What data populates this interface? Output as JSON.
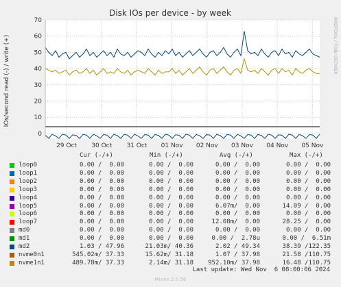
{
  "title": "Disk IOs per device - by week",
  "side_label": "RRDTOOL / TOBI OETIKER",
  "ylabel": "IOs/second read (-) / write (+)",
  "footer": "Munin 2.0.56",
  "last_update": "Last update: Wed Nov  6 08:00:06 2024",
  "legend_headers": {
    "cur": "Cur (-/+)",
    "min": "Min (-/+)",
    "avg": "Avg (-/+)",
    "max": "Max (-/+)"
  },
  "legend": [
    {
      "name": "loop0",
      "color": "#00cc00",
      "cur": "0.00 /  0.00",
      "min": "0.00 /  0.00",
      "avg": "0.00 /  0.00",
      "max": "0.00 /  0.00"
    },
    {
      "name": "loop1",
      "color": "#0066b3",
      "cur": "0.00 /  0.00",
      "min": "0.00 /  0.00",
      "avg": "0.00 /  0.00",
      "max": "0.00 /  0.00"
    },
    {
      "name": "loop2",
      "color": "#ff8000",
      "cur": "0.00 /  0.00",
      "min": "0.00 /  0.00",
      "avg": "0.00 /  0.00",
      "max": "0.00 /  0.00"
    },
    {
      "name": "loop3",
      "color": "#ffcc00",
      "cur": "0.00 /  0.00",
      "min": "0.00 /  0.00",
      "avg": "0.00 /  0.00",
      "max": "0.00 /  0.00"
    },
    {
      "name": "loop4",
      "color": "#330099",
      "cur": "0.00 /  0.00",
      "min": "0.00 /  0.00",
      "avg": "0.00 /  0.00",
      "max": "0.00 /  0.00"
    },
    {
      "name": "loop5",
      "color": "#990099",
      "cur": "0.00 /  0.00",
      "min": "0.00 /  0.00",
      "avg": "6.07m/  0.00",
      "max": "14.09 /  0.00"
    },
    {
      "name": "loop6",
      "color": "#ccff00",
      "cur": "0.00 /  0.00",
      "min": "0.00 /  0.00",
      "avg": "0.00 /  0.00",
      "max": "0.00 /  0.00"
    },
    {
      "name": "loop7",
      "color": "#ff0000",
      "cur": "0.00 /  0.00",
      "min": "0.00 /  0.00",
      "avg": "12.08m/  0.00",
      "max": "28.25 /  0.00"
    },
    {
      "name": "md0",
      "color": "#808080",
      "cur": "0.00 /  0.00",
      "min": "0.00 /  0.00",
      "avg": "0.00 /  0.00",
      "max": "0.00 /  0.00"
    },
    {
      "name": "md1",
      "color": "#008f00",
      "cur": "0.00 /  0.00",
      "min": "0.00 /  0.00",
      "avg": "0.00 /  2.78u",
      "max": "0.00 /  6.51m"
    },
    {
      "name": "md2",
      "color": "#00487d",
      "cur": "1.03 / 47.96",
      "min": "21.03m/ 40.36",
      "avg": "2.02 / 49.34",
      "max": "38.39 /122.35"
    },
    {
      "name": "nvme0n1",
      "color": "#b35a00",
      "cur": "545.02m/ 37.33",
      "min": "15.62m/ 31.18",
      "avg": "1.07 / 37.98",
      "max": "21.58 /110.75"
    },
    {
      "name": "nvme1n1",
      "color": "#b38f00",
      "cur": "489.78m/ 37.33",
      "min": "2.14m/ 31.18",
      "avg": "952.10m/ 37.98",
      "max": "16.48 /110.75"
    }
  ],
  "chart_data": {
    "type": "line",
    "title": "Disk IOs per device - by week",
    "ylabel": "IOs/second read (-) / write (+)",
    "ylim": [
      -3,
      70
    ],
    "yticks": [
      "0",
      "10",
      "20",
      "30",
      "40",
      "50",
      "60",
      "70"
    ],
    "x_categories": [
      "29 Oct",
      "30 Oct",
      "31 Oct",
      "01 Nov",
      "02 Nov",
      "03 Nov",
      "04 Nov",
      "05 Nov"
    ],
    "grid": true,
    "series": [
      {
        "name": "md2",
        "color": "#00487d",
        "x": [
          0,
          1,
          2,
          3,
          4,
          5,
          6,
          7,
          8,
          9,
          10,
          11,
          12,
          13,
          14,
          15,
          16,
          17,
          18,
          19,
          20,
          21,
          22,
          23,
          24,
          25,
          26,
          27,
          28,
          29,
          30,
          31,
          32,
          33,
          34,
          35,
          36,
          37,
          38,
          39,
          40,
          41,
          42,
          43,
          44,
          45,
          46,
          47,
          48,
          49,
          50,
          51,
          52,
          53,
          54,
          55,
          56,
          57,
          58,
          59,
          60,
          61,
          62,
          63,
          64,
          65,
          66,
          67,
          68,
          69,
          70,
          71,
          72,
          73,
          74,
          75,
          76,
          77,
          78,
          79,
          80
        ],
        "values": [
          53,
          50,
          48,
          51,
          47,
          49,
          50,
          46,
          48,
          50,
          47,
          49,
          52,
          48,
          50,
          47,
          49,
          51,
          48,
          50,
          47,
          52,
          49,
          48,
          50,
          47,
          49,
          51,
          50,
          48,
          52,
          49,
          47,
          50,
          48,
          51,
          49,
          52,
          48,
          50,
          47,
          49,
          51,
          48,
          50,
          52,
          49,
          47,
          50,
          51,
          48,
          50,
          53,
          49,
          47,
          50,
          52,
          48,
          63,
          51,
          49,
          50,
          48,
          52,
          49,
          47,
          50,
          51,
          48,
          52,
          49,
          50,
          47,
          51,
          49,
          48,
          50,
          52,
          49,
          48,
          47
        ]
      },
      {
        "name": "nvme1n1",
        "color": "#b38f00",
        "x": [
          0,
          1,
          2,
          3,
          4,
          5,
          6,
          7,
          8,
          9,
          10,
          11,
          12,
          13,
          14,
          15,
          16,
          17,
          18,
          19,
          20,
          21,
          22,
          23,
          24,
          25,
          26,
          27,
          28,
          29,
          30,
          31,
          32,
          33,
          34,
          35,
          36,
          37,
          38,
          39,
          40,
          41,
          42,
          43,
          44,
          45,
          46,
          47,
          48,
          49,
          50,
          51,
          52,
          53,
          54,
          55,
          56,
          57,
          58,
          59,
          60,
          61,
          62,
          63,
          64,
          65,
          66,
          67,
          68,
          69,
          70,
          71,
          72,
          73,
          74,
          75,
          76,
          77,
          78,
          79,
          80
        ],
        "values": [
          40,
          39,
          38,
          39,
          37,
          38,
          39,
          36,
          38,
          39,
          37,
          38,
          40,
          37,
          39,
          36,
          38,
          40,
          37,
          38,
          37,
          40,
          38,
          37,
          39,
          36,
          38,
          39,
          38,
          37,
          40,
          38,
          36,
          39,
          37,
          38,
          38,
          40,
          37,
          39,
          36,
          38,
          40,
          37,
          39,
          41,
          38,
          36,
          39,
          40,
          37,
          39,
          41,
          38,
          36,
          39,
          40,
          37,
          46,
          39,
          38,
          39,
          37,
          40,
          38,
          36,
          39,
          40,
          37,
          40,
          38,
          39,
          36,
          40,
          38,
          37,
          39,
          40,
          38,
          37,
          37
        ]
      },
      {
        "name": "md2 (read)",
        "color": "#00487d",
        "x": [
          0,
          1,
          2,
          3,
          4,
          5,
          6,
          7,
          8,
          9,
          10,
          11,
          12,
          13,
          14,
          15,
          16,
          17,
          18,
          19,
          20,
          21,
          22,
          23,
          24,
          25,
          26,
          27,
          28,
          29,
          30,
          31,
          32,
          33,
          34,
          35,
          36,
          37,
          38,
          39,
          40,
          41,
          42,
          43,
          44,
          45,
          46,
          47,
          48,
          49,
          50,
          51,
          52,
          53,
          54,
          55,
          56,
          57,
          58,
          59,
          60,
          61,
          62,
          63,
          64,
          65,
          66,
          67,
          68,
          69,
          70,
          71,
          72,
          73,
          74,
          75,
          76,
          77,
          78,
          79,
          80
        ],
        "values": [
          -1,
          -3,
          -0.5,
          -1.5,
          -3,
          -0.5,
          -1,
          -3,
          -0.8,
          -1.2,
          -3,
          -0.6,
          -1,
          -3,
          -0.5,
          -1.4,
          -3,
          -0.7,
          -1,
          -3,
          -0.5,
          -1.3,
          -3,
          -0.6,
          -1,
          -3,
          -0.5,
          -1.5,
          -3,
          -0.7,
          -1,
          -3,
          -0.6,
          -1.2,
          -3,
          -0.5,
          -1,
          -3,
          -0.8,
          -1.1,
          -3,
          -0.5,
          -1,
          -3,
          -0.6,
          -1.4,
          -3,
          -0.7,
          -1,
          -3,
          -0.5,
          -1.3,
          -3,
          -0.6,
          -1,
          -3,
          -0.5,
          -1.5,
          -3,
          -0.7,
          -1,
          -3,
          -0.6,
          -1.2,
          -3,
          -0.5,
          -1,
          -3,
          -0.8,
          -1.1,
          -3,
          -0.5,
          -1,
          -3,
          -0.6,
          -1.4,
          -3,
          -0.7,
          -1,
          -3,
          -0.5
        ]
      }
    ]
  }
}
